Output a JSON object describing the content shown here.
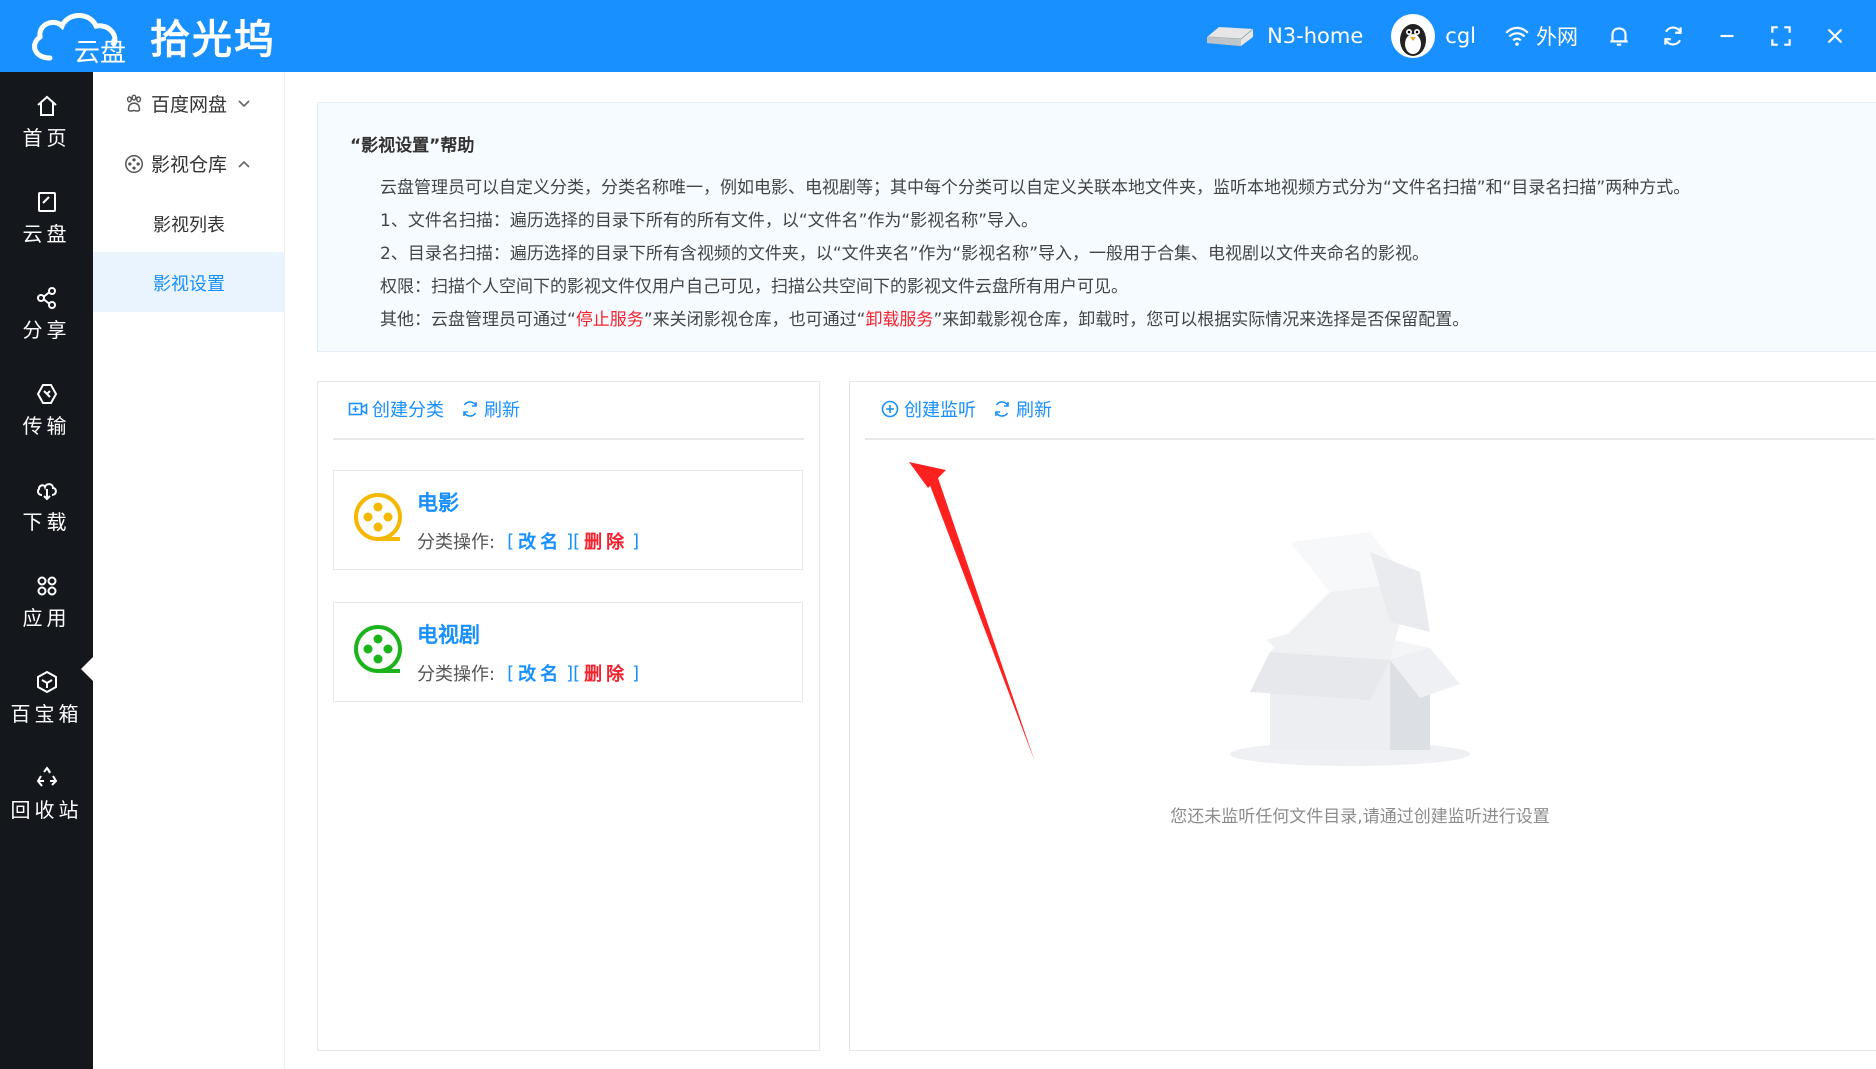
{
  "header": {
    "logo_sub": "云盘",
    "brand": "拾光坞",
    "device": "N3-home",
    "user": "cgl",
    "network": "外网",
    "icons": [
      "nas-device-icon",
      "avatar",
      "wifi-icon",
      "bell-icon",
      "refresh-icon",
      "minimize-icon",
      "fullscreen-icon",
      "close-icon"
    ]
  },
  "leftnav": {
    "items": [
      {
        "label": "首页",
        "icon": "home-icon"
      },
      {
        "label": "云盘",
        "icon": "cloud-disk-icon"
      },
      {
        "label": "分享",
        "icon": "share-icon"
      },
      {
        "label": "传输",
        "icon": "transfer-icon"
      },
      {
        "label": "下载",
        "icon": "download-icon"
      },
      {
        "label": "应用",
        "icon": "apps-icon"
      },
      {
        "label": "百宝箱",
        "icon": "toolbox-icon"
      },
      {
        "label": "回收站",
        "icon": "recycle-icon"
      }
    ],
    "active": "应用"
  },
  "subnav": {
    "groups": [
      {
        "label": "百度网盘",
        "icon": "baidu-icon",
        "expanded": false
      },
      {
        "label": "影视仓库",
        "icon": "film-icon",
        "expanded": true
      }
    ],
    "items": [
      "影视列表",
      "影视设置"
    ],
    "active": "影视设置"
  },
  "help": {
    "title": "“影视设置”帮助",
    "lines": [
      "云盘管理员可以自定义分类，分类名称唯一，例如电影、电视剧等；其中每个分类可以自定义关联本地文件夹，监听本地视频方式分为“文件名扫描”和“目录名扫描”两种方式。",
      "1、文件名扫描：遍历选择的目录下所有的所有文件，以“文件名”作为“影视名称”导入。",
      "2、目录名扫描：遍历选择的目录下所有含视频的文件夹，以“文件夹名”作为“影视名称”导入，一般用于合集、电视剧以文件夹命名的影视。",
      "权限：扫描个人空间下的影视文件仅用户自己可见，扫描公共空间下的影视文件云盘所有用户可见。"
    ],
    "other_prefix": "其他：云盘管理员可通过“",
    "stop_service": "停止服务",
    "other_mid": "”来关闭影视仓库，也可通过“",
    "uninstall_service": "卸载服务",
    "other_suffix": "”来卸载影视仓库，卸载时，您可以根据实际情况来选择是否保留配置。"
  },
  "category_panel": {
    "create_label": "创建分类",
    "refresh_label": "刷新",
    "ops_label": "分类操作:",
    "edit_label": "改名",
    "delete_label": "删除",
    "categories": [
      {
        "name": "电影",
        "color": "#f5b800"
      },
      {
        "name": "电视剧",
        "color": "#1db31d"
      }
    ]
  },
  "monitor_panel": {
    "create_label": "创建监听",
    "refresh_label": "刷新",
    "empty_text": "您还未监听任何文件目录,请通过创建监听进行设置"
  },
  "colors": {
    "primary": "#1890ff",
    "danger": "#f5222d",
    "nav_bg": "#14171c"
  }
}
